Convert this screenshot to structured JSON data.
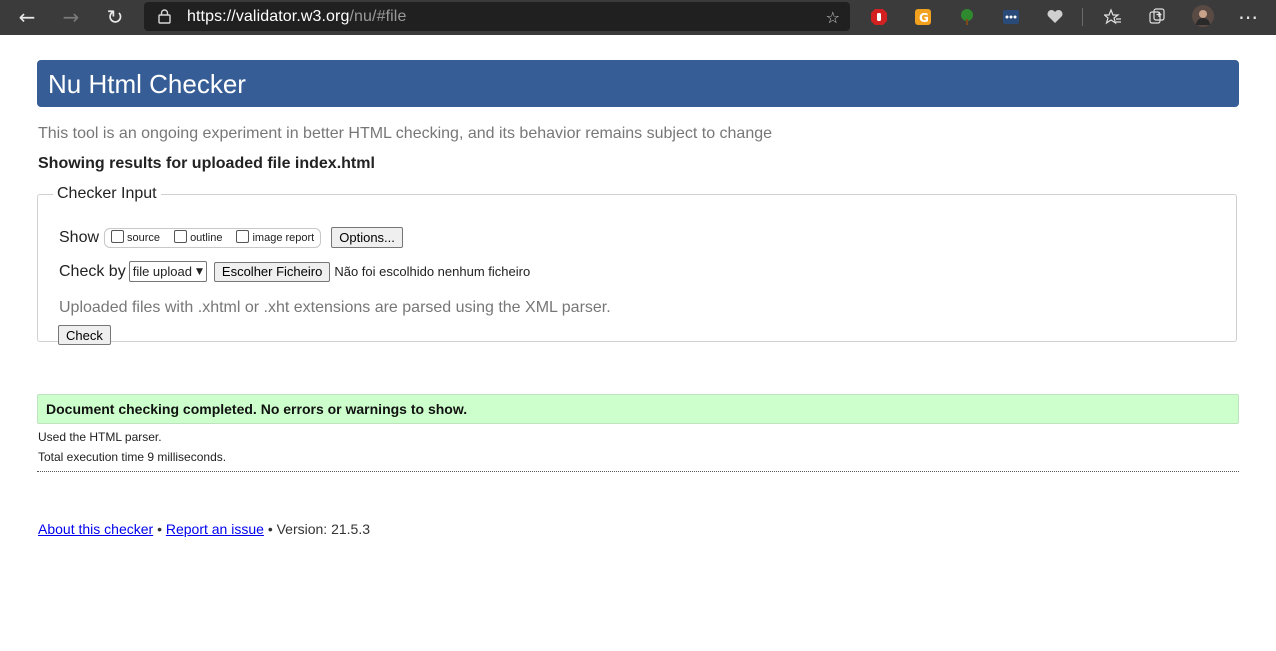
{
  "browser": {
    "url_host": "https://validator.w3.org",
    "url_path": "/nu/#file"
  },
  "page": {
    "title": "Nu Html Checker",
    "intro": "This tool is an ongoing experiment in better HTML checking, and its behavior remains subject to change",
    "showing": "Showing results for uploaded file index.html",
    "checker": {
      "legend": "Checker Input",
      "show_label": "Show",
      "show_options": [
        "source",
        "outline",
        "image report"
      ],
      "options_button": "Options...",
      "check_by_label": "Check by",
      "check_by_value": "file upload",
      "choose_file_button": "Escolher Ficheiro",
      "no_file_text": "Não foi escolhido nenhum ficheiro",
      "hint": "Uploaded files with .xhtml or .xht extensions are parsed using the XML parser.",
      "check_button": "Check"
    },
    "result": "Document checking completed. No errors or warnings to show.",
    "parser_line": "Used the HTML parser.",
    "time_line": "Total execution time 9 milliseconds.",
    "footer": {
      "about_link": "About this checker",
      "bullet": "•",
      "report_link": "Report an issue",
      "version": "• Version: 21.5.3"
    }
  },
  "colors": {
    "header_bg": "#365d95",
    "result_bg": "#ccffcc",
    "browser_bg": "#3b3b3b"
  }
}
